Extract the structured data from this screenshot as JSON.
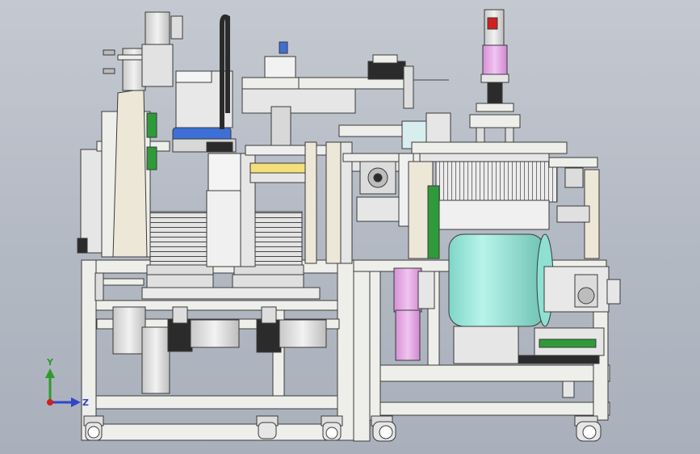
{
  "triad": {
    "y_label": "Y",
    "z_label": "Z",
    "colors": {
      "y": "#2e9a2e",
      "z": "#2f46c8",
      "x": "#d02020"
    }
  },
  "palette": {
    "frame": "#eeeeea",
    "frame_edge": "#3a3a3a",
    "motor": "#dadada",
    "pink": "#e2a8e2",
    "cyan": "#9ee8dc",
    "blue": "#3d6fd6",
    "dark": "#2b2b2b",
    "green": "#2f9a3a",
    "tan": "#ede7d8"
  }
}
